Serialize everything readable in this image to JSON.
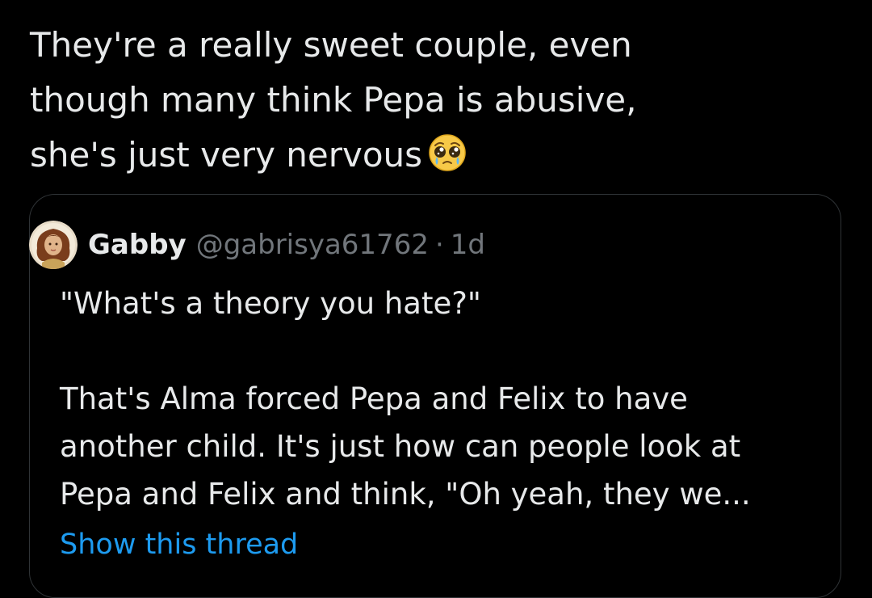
{
  "tweet": {
    "text": "They're a really sweet couple, even\nthough many think Pepa is abusive,\nshe's just very nervous",
    "emoji_icon": "pleading-face-icon"
  },
  "quote": {
    "author_name": "Gabby",
    "author_handle": "@gabrisya61762",
    "separator": "·",
    "timestamp": "1d",
    "body": "\"What's a theory you hate?\"\n\nThat's Alma forced Pepa and Felix to have\nanother child. It's just how can people look at\nPepa and Felix and think, \"Oh yeah, they we...",
    "show_thread_label": "Show this thread"
  },
  "colors": {
    "background": "#000000",
    "text_primary": "#e7e9ea",
    "text_secondary": "#71767b",
    "link": "#1d9bf0",
    "border": "#2f3336"
  }
}
